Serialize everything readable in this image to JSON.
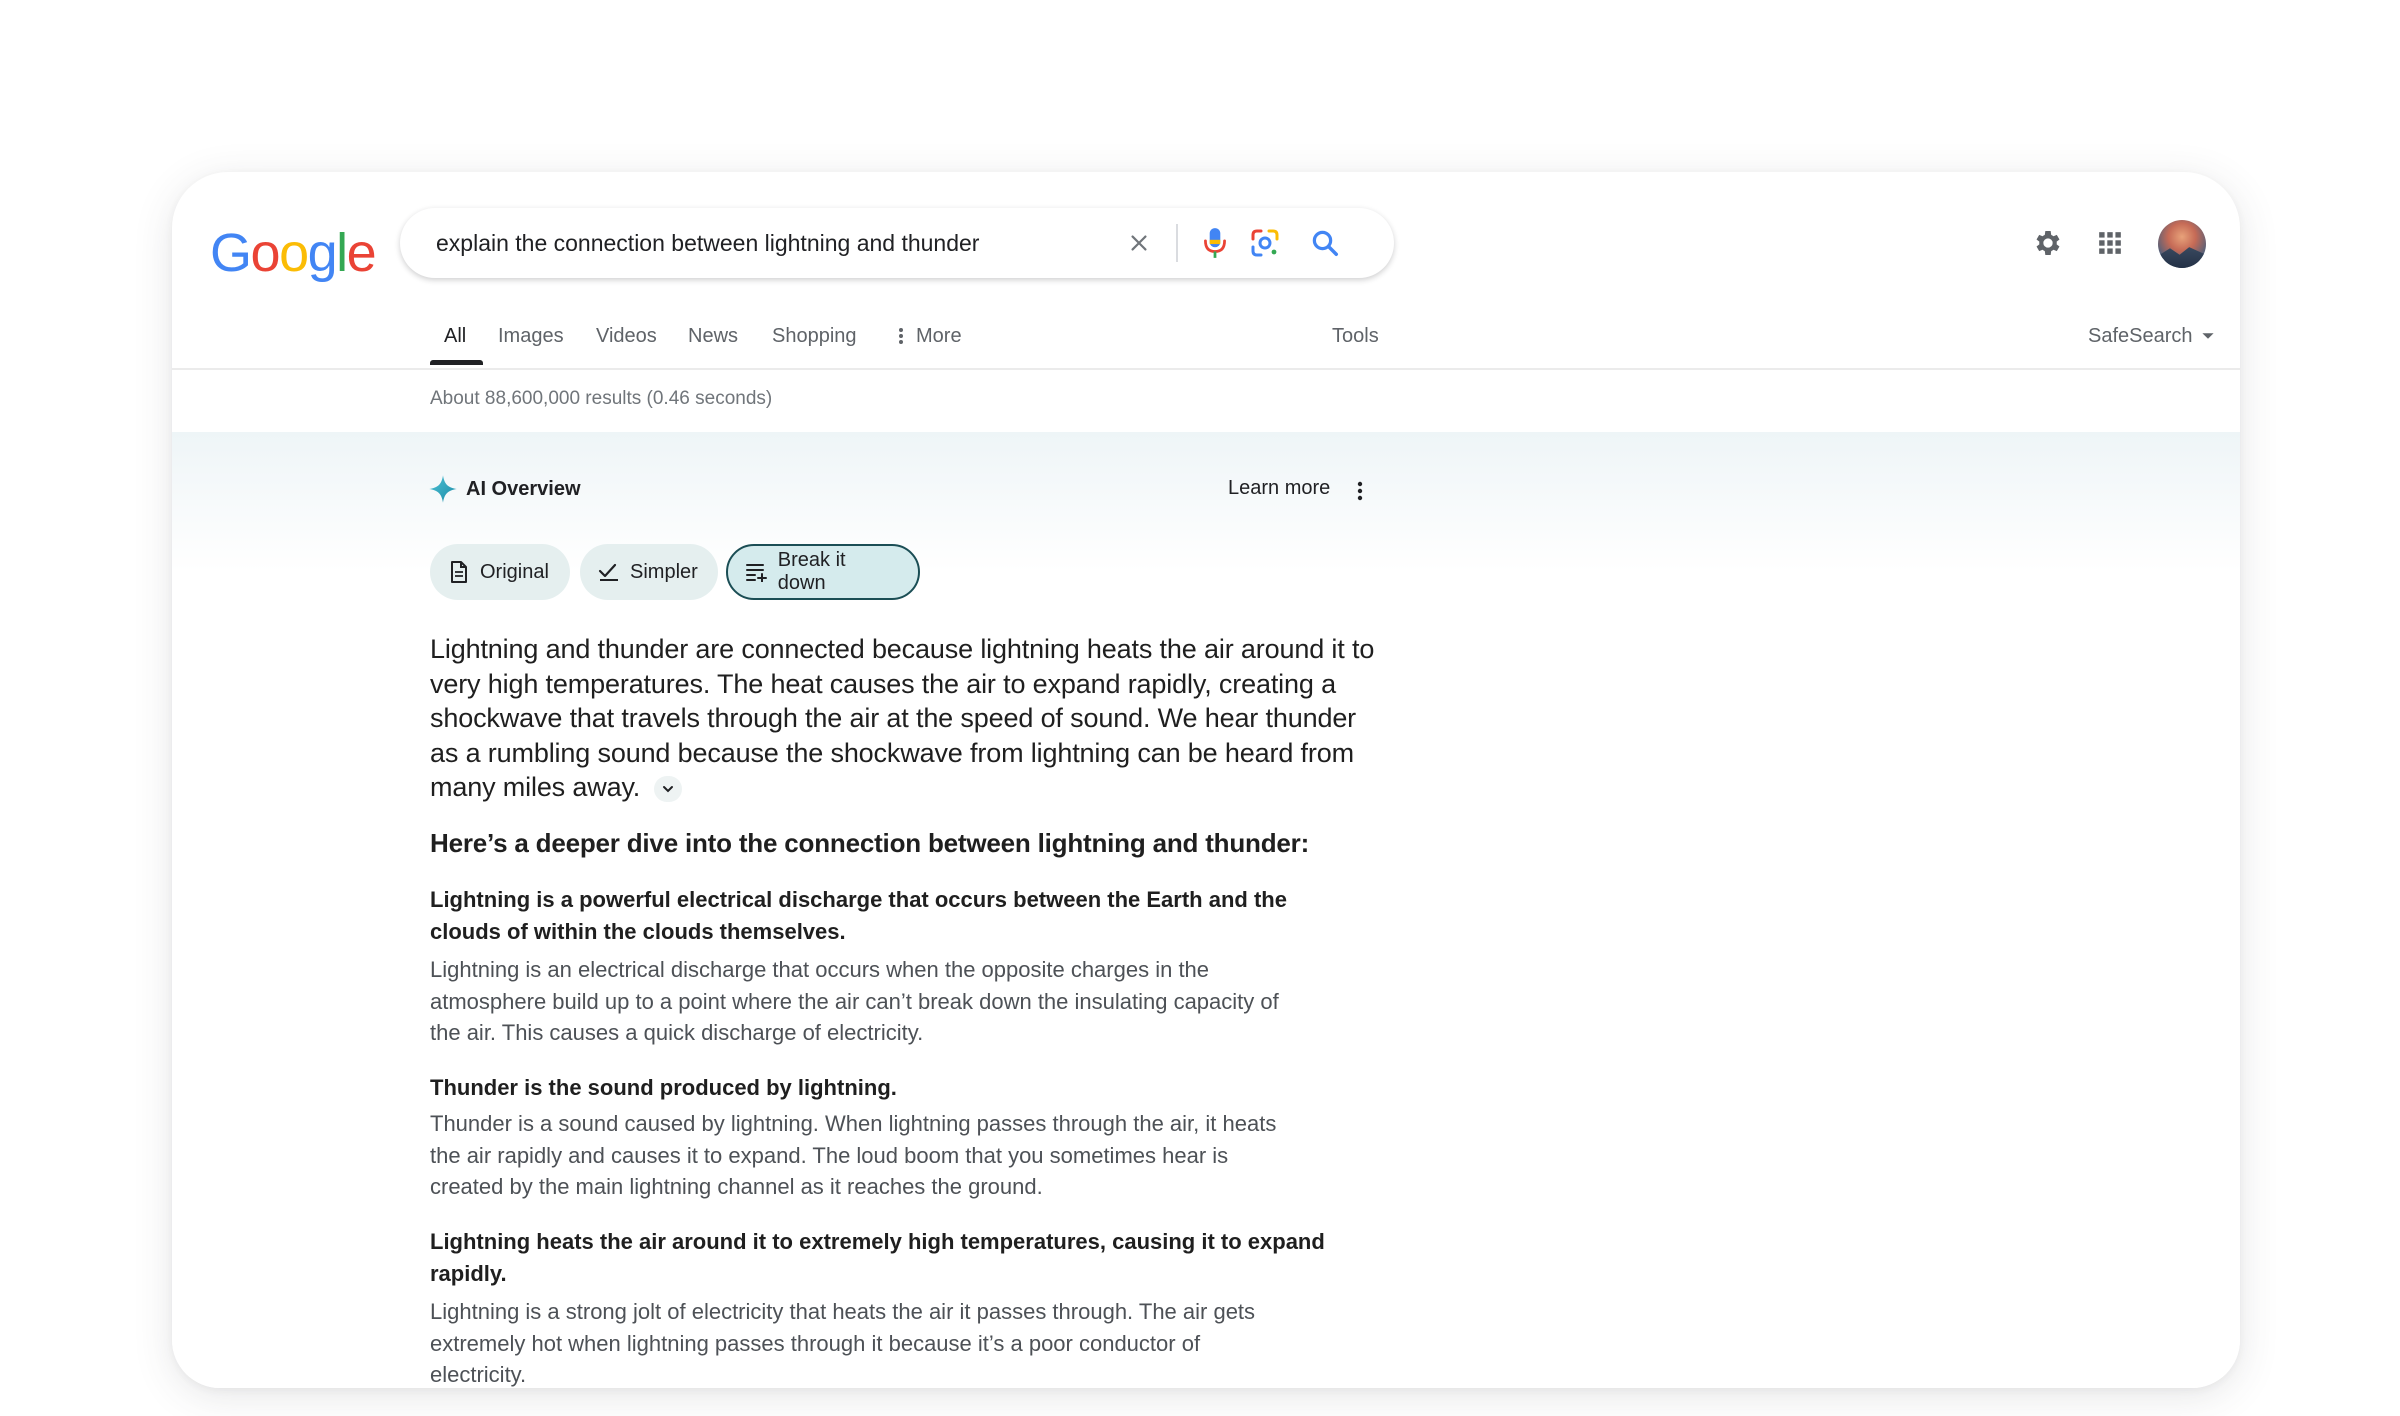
{
  "header": {
    "logo_letters": [
      {
        "ch": "G",
        "color": "#4285F4"
      },
      {
        "ch": "o",
        "color": "#EA4335"
      },
      {
        "ch": "o",
        "color": "#FBBC05"
      },
      {
        "ch": "g",
        "color": "#4285F4"
      },
      {
        "ch": "l",
        "color": "#34A853"
      },
      {
        "ch": "e",
        "color": "#EA4335"
      }
    ],
    "search_query": "explain the connection between lightning and thunder",
    "icons": [
      "clear-icon",
      "microphone-icon",
      "lens-icon",
      "search-icon",
      "settings-icon",
      "apps-grid-icon",
      "avatar"
    ]
  },
  "tabs": {
    "items": [
      "All",
      "Images",
      "Videos",
      "News",
      "Shopping",
      "More"
    ],
    "active": "All",
    "tools": "Tools",
    "safesearch": "SafeSearch"
  },
  "results_count": "About 88,600,000 results (0.46 seconds)",
  "ai_overview": {
    "title": "AI Overview",
    "learn_more": "Learn more",
    "chips": {
      "original": "Original",
      "simpler": "Simpler",
      "break_down": "Break it down",
      "selected": "Break it down"
    },
    "summary": "Lightning and thunder are connected because lightning heats the air around it to very high temperatures. The heat causes the air to expand rapidly, creating a shockwave that travels through the air at the speed of sound. We hear thunder as a rumbling sound because the shockwave from lightning can be heard from many miles away.",
    "deeper_heading": "Here’s a deeper dive into the connection between lightning and thunder:",
    "items": [
      {
        "title": "Lightning is a powerful electrical discharge that occurs between the Earth and the clouds of within the clouds themselves.",
        "body": "Lightning is an electrical discharge that occurs when the opposite charges in the atmosphere build up to a point where the air can’t break down the insulating capacity of the air. This causes a quick discharge of electricity."
      },
      {
        "title": "Thunder is the sound produced by lightning.",
        "body": "Thunder is a sound caused by lightning. When lightning passes through the air, it heats the air rapidly and causes it to expand. The loud boom that you sometimes hear is created by the main lightning channel as it reaches the ground."
      },
      {
        "title": "Lightning heats the air around it to extremely high temperatures, causing it to expand rapidly.",
        "body": "Lightning is a strong jolt of electricity that heats the air it passes through. The air gets extremely hot when lightning passes through it because it’s a poor conductor of electricity."
      }
    ]
  },
  "colors": {
    "ai_accent": "#1a9fb5",
    "chip_bg": "#e5efef",
    "chip_selected_border": "#1b4e55"
  }
}
